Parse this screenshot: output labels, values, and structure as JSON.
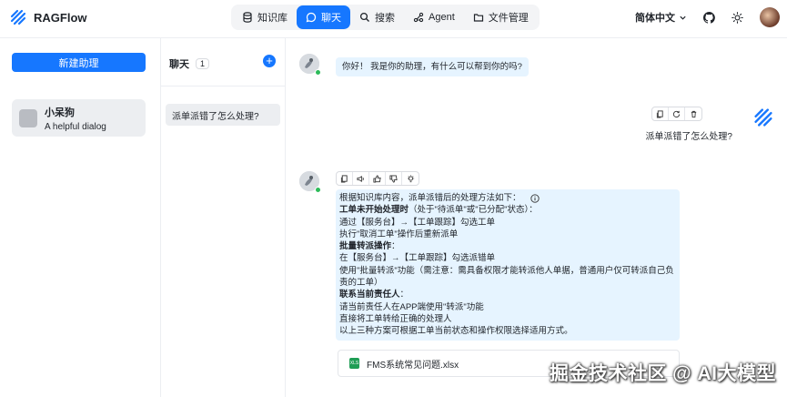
{
  "app": {
    "name": "RAGFlow"
  },
  "nav": [
    {
      "label": "知识库",
      "icon": "database-icon",
      "active": false
    },
    {
      "label": "聊天",
      "icon": "chat-icon",
      "active": true
    },
    {
      "label": "搜索",
      "icon": "search-icon",
      "active": false
    },
    {
      "label": "Agent",
      "icon": "agent-icon",
      "active": false
    },
    {
      "label": "文件管理",
      "icon": "folder-icon",
      "active": false
    }
  ],
  "header": {
    "language": "简体中文"
  },
  "sidebar": {
    "new_assistant": "新建助理",
    "assistant": {
      "name": "小呆狗",
      "description": "A helpful dialog"
    }
  },
  "chats": {
    "title": "聊天",
    "count": "1",
    "items": [
      {
        "title": "派单派错了怎么处理?"
      }
    ]
  },
  "conversation": {
    "greeting": "你好！ 我是你的助理，有什么可以帮到你的吗?",
    "user_question": "派单派错了怎么处理?",
    "answer": {
      "intro": "根据知识库内容，派单派错后的处理方法如下：",
      "s1_title": "工单未开始处理时",
      "s1_suffix": "（处于\"待派单\"或\"已分配\"状态）：",
      "s1_l1": "通过【服务台】→【工单跟踪】勾选工单",
      "s1_l2": "执行\"取消工单\"操作后重新派单",
      "s2_title": "批量转派操作",
      "s2_suffix": "：",
      "s2_l1": "在【服务台】→【工单跟踪】勾选派错单",
      "s2_l2": "使用\"批量转派\"功能（需注意：需具备权限才能转派他人单据，普通用户仅可转派自己负责的工单）",
      "s3_title": "联系当前责任人",
      "s3_suffix": "：",
      "s3_l1": "请当前责任人在APP端使用\"转派\"功能",
      "s3_l2": "直接将工单转给正确的处理人",
      "conclusion": "以上三种方案可根据工单当前状态和操作权限选择适用方式。"
    },
    "attachment": {
      "name": "FMS系统常见问题.xlsx"
    }
  },
  "watermark": "掘金技术社区 @ AI大模型",
  "colors": {
    "primary": "#1677ff",
    "bubble": "#e6f4ff",
    "online": "#2dbb5a"
  }
}
